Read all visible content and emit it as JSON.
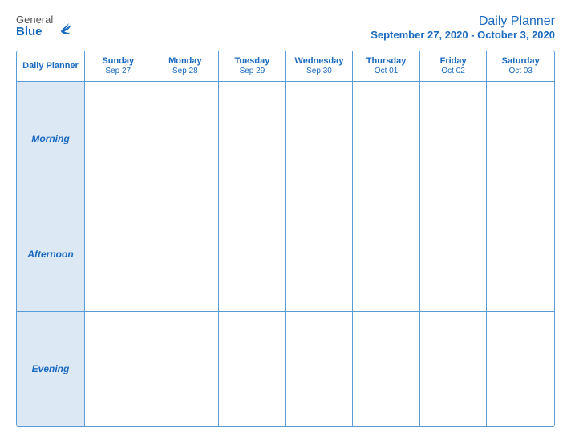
{
  "logo": {
    "general": "General",
    "blue": "Blue"
  },
  "title": {
    "main": "Daily Planner",
    "date_range": "September 27, 2020 - October 3, 2020"
  },
  "columns": [
    {
      "day": "Daily\nPlanner",
      "date": ""
    },
    {
      "day": "Sunday",
      "date": "Sep 27"
    },
    {
      "day": "Monday",
      "date": "Sep 28"
    },
    {
      "day": "Tuesday",
      "date": "Sep 29"
    },
    {
      "day": "Wednesday",
      "date": "Sep 30"
    },
    {
      "day": "Thursday",
      "date": "Oct 01"
    },
    {
      "day": "Friday",
      "date": "Oct 02"
    },
    {
      "day": "Saturday",
      "date": "Oct 03"
    }
  ],
  "rows": [
    {
      "label": "Morning"
    },
    {
      "label": "Afternoon"
    },
    {
      "label": "Evening"
    }
  ]
}
